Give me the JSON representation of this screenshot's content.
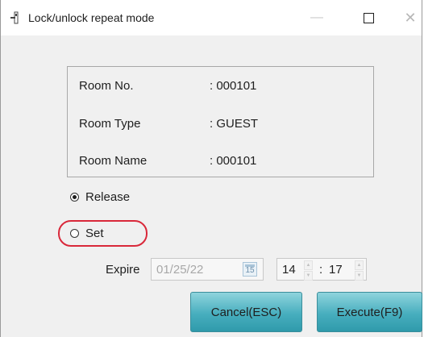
{
  "window": {
    "title": "Lock/unlock repeat mode",
    "minimize_glyph": "—",
    "close_glyph": "✕"
  },
  "room_info": {
    "rows": [
      {
        "label": "Room No.",
        "value": ": 000101"
      },
      {
        "label": "Room Type",
        "value": ": GUEST"
      },
      {
        "label": "Room Name",
        "value": ": 000101"
      }
    ]
  },
  "mode": {
    "options": [
      {
        "label": "Release",
        "checked": true
      },
      {
        "label": "Set",
        "checked": false
      }
    ],
    "highlight_color": "#d9283a"
  },
  "expire": {
    "label": "Expire",
    "date_value": "01/25/22",
    "calendar_day": "15",
    "hour": "14",
    "minute": "17",
    "time_separator": ":"
  },
  "buttons": {
    "cancel": "Cancel(ESC)",
    "execute": "Execute(F9)",
    "accent": "#47aebe"
  }
}
